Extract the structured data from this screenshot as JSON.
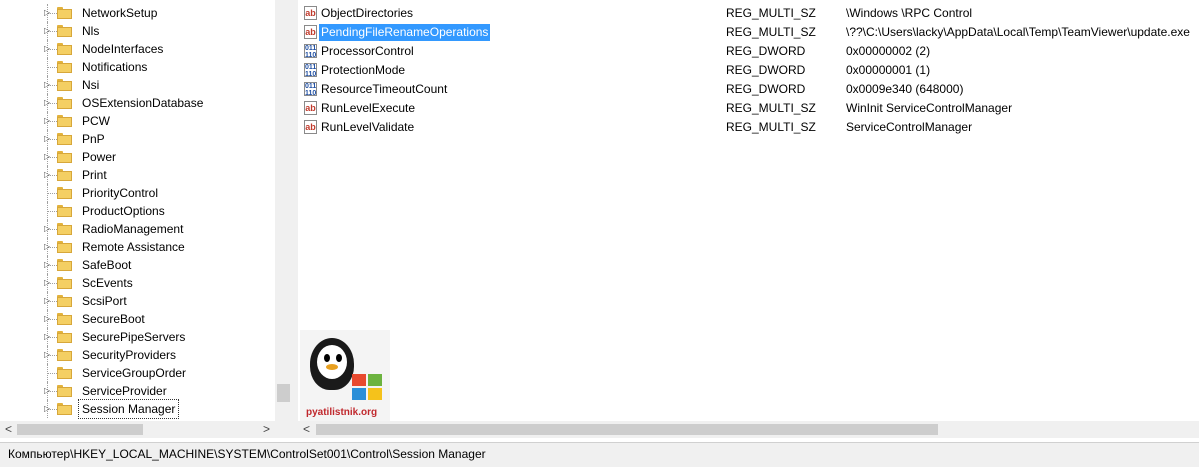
{
  "tree": {
    "items": [
      {
        "label": "NetworkSetup",
        "expandable": true
      },
      {
        "label": "Nls",
        "expandable": true
      },
      {
        "label": "NodeInterfaces",
        "expandable": true
      },
      {
        "label": "Notifications",
        "expandable": false
      },
      {
        "label": "Nsi",
        "expandable": true
      },
      {
        "label": "OSExtensionDatabase",
        "expandable": true
      },
      {
        "label": "PCW",
        "expandable": true
      },
      {
        "label": "PnP",
        "expandable": true
      },
      {
        "label": "Power",
        "expandable": true
      },
      {
        "label": "Print",
        "expandable": true
      },
      {
        "label": "PriorityControl",
        "expandable": false
      },
      {
        "label": "ProductOptions",
        "expandable": false
      },
      {
        "label": "RadioManagement",
        "expandable": true
      },
      {
        "label": "Remote Assistance",
        "expandable": true
      },
      {
        "label": "SafeBoot",
        "expandable": true
      },
      {
        "label": "ScEvents",
        "expandable": true
      },
      {
        "label": "ScsiPort",
        "expandable": true
      },
      {
        "label": "SecureBoot",
        "expandable": true
      },
      {
        "label": "SecurePipeServers",
        "expandable": true
      },
      {
        "label": "SecurityProviders",
        "expandable": true
      },
      {
        "label": "ServiceGroupOrder",
        "expandable": false
      },
      {
        "label": "ServiceProvider",
        "expandable": true
      },
      {
        "label": "Session Manager",
        "expandable": true,
        "selected": true
      }
    ]
  },
  "values": {
    "rows": [
      {
        "icon": "string-value-icon",
        "icon_text": "ab",
        "name": "ObjectDirectories",
        "type": "REG_MULTI_SZ",
        "data": "\\Windows \\RPC Control"
      },
      {
        "icon": "string-value-icon",
        "icon_text": "ab",
        "name": "PendingFileRenameOperations",
        "type": "REG_MULTI_SZ",
        "data": "\\??\\C:\\Users\\lacky\\AppData\\Local\\Temp\\TeamViewer\\update.exe",
        "selected": true
      },
      {
        "icon": "binary-value-icon",
        "icon_text": "011\n110",
        "name": "ProcessorControl",
        "type": "REG_DWORD",
        "data": "0x00000002 (2)"
      },
      {
        "icon": "binary-value-icon",
        "icon_text": "011\n110",
        "name": "ProtectionMode",
        "type": "REG_DWORD",
        "data": "0x00000001 (1)"
      },
      {
        "icon": "binary-value-icon",
        "icon_text": "011\n110",
        "name": "ResourceTimeoutCount",
        "type": "REG_DWORD",
        "data": "0x0009e340 (648000)"
      },
      {
        "icon": "string-value-icon",
        "icon_text": "ab",
        "name": "RunLevelExecute",
        "type": "REG_MULTI_SZ",
        "data": "WinInit ServiceControlManager"
      },
      {
        "icon": "string-value-icon",
        "icon_text": "ab",
        "name": "RunLevelValidate",
        "type": "REG_MULTI_SZ",
        "data": "ServiceControlManager"
      }
    ]
  },
  "logo": {
    "text": "pyatilistnik.org"
  },
  "scrollbars": {
    "left_arrow": "<",
    "right_arrow": ">"
  },
  "status_bar": {
    "path": "Компьютер\\HKEY_LOCAL_MACHINE\\SYSTEM\\ControlSet001\\Control\\Session Manager"
  },
  "colors": {
    "selection": "#3399ff",
    "folder": "#f4cf63",
    "chrome": "#f0f0f0"
  }
}
